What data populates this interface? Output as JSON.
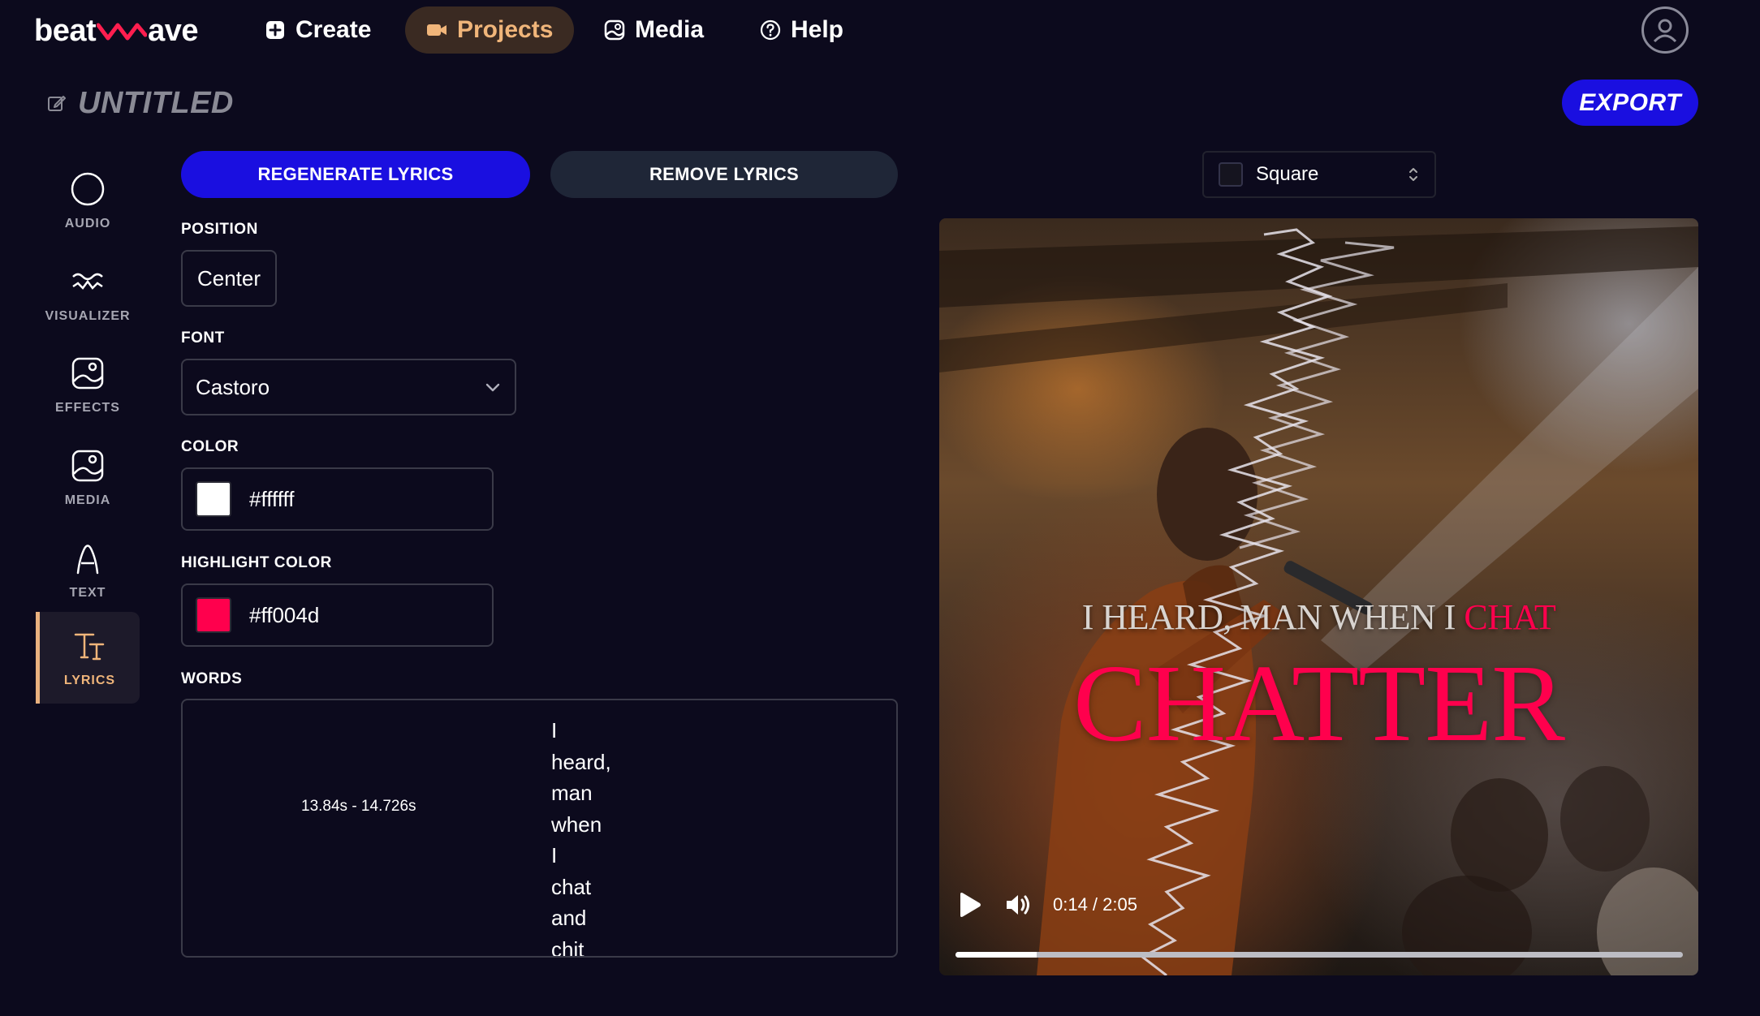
{
  "brand": {
    "left": "beat",
    "right": "ave"
  },
  "nav": {
    "create": "Create",
    "projects": "Projects",
    "media": "Media",
    "help": "Help"
  },
  "project": {
    "title": "UNTITLED",
    "export_label": "EXPORT"
  },
  "sidebar": {
    "items": [
      {
        "label": "AUDIO",
        "icon": "circle-icon"
      },
      {
        "label": "VISUALIZER",
        "icon": "wave-icon"
      },
      {
        "label": "EFFECTS",
        "icon": "image-icon"
      },
      {
        "label": "MEDIA",
        "icon": "image-icon"
      },
      {
        "label": "TEXT",
        "icon": "letter-a-icon"
      },
      {
        "label": "LYRICS",
        "icon": "text-size-icon"
      }
    ],
    "active": "LYRICS"
  },
  "lyrics_panel": {
    "regenerate_label": "REGENERATE LYRICS",
    "remove_label": "REMOVE LYRICS",
    "position_label": "POSITION",
    "position_value": "Center",
    "font_label": "FONT",
    "font_value": "Castoro",
    "color_label": "COLOR",
    "color_value": "#ffffff",
    "highlight_label": "HIGHLIGHT COLOR",
    "highlight_value": "#ff004d",
    "words_label": "WORDS",
    "words": {
      "time_range": "13.84s - 14.726s",
      "list": [
        "I",
        "heard,",
        "man",
        "when",
        "I",
        "chat",
        "and",
        "chit"
      ]
    }
  },
  "preview": {
    "aspect": "Square",
    "lyric_line_normal": "I HEARD, MAN WHEN I ",
    "lyric_line_highlight": "CHAT",
    "lyric_big": "CHATTER",
    "time": "0:14 / 2:05",
    "progress_fraction": 0.112
  },
  "colors": {
    "accent_blue": "#1a0fe0",
    "accent_orange": "#f0b57a",
    "highlight": "#ff004d",
    "text_color": "#ffffff"
  }
}
